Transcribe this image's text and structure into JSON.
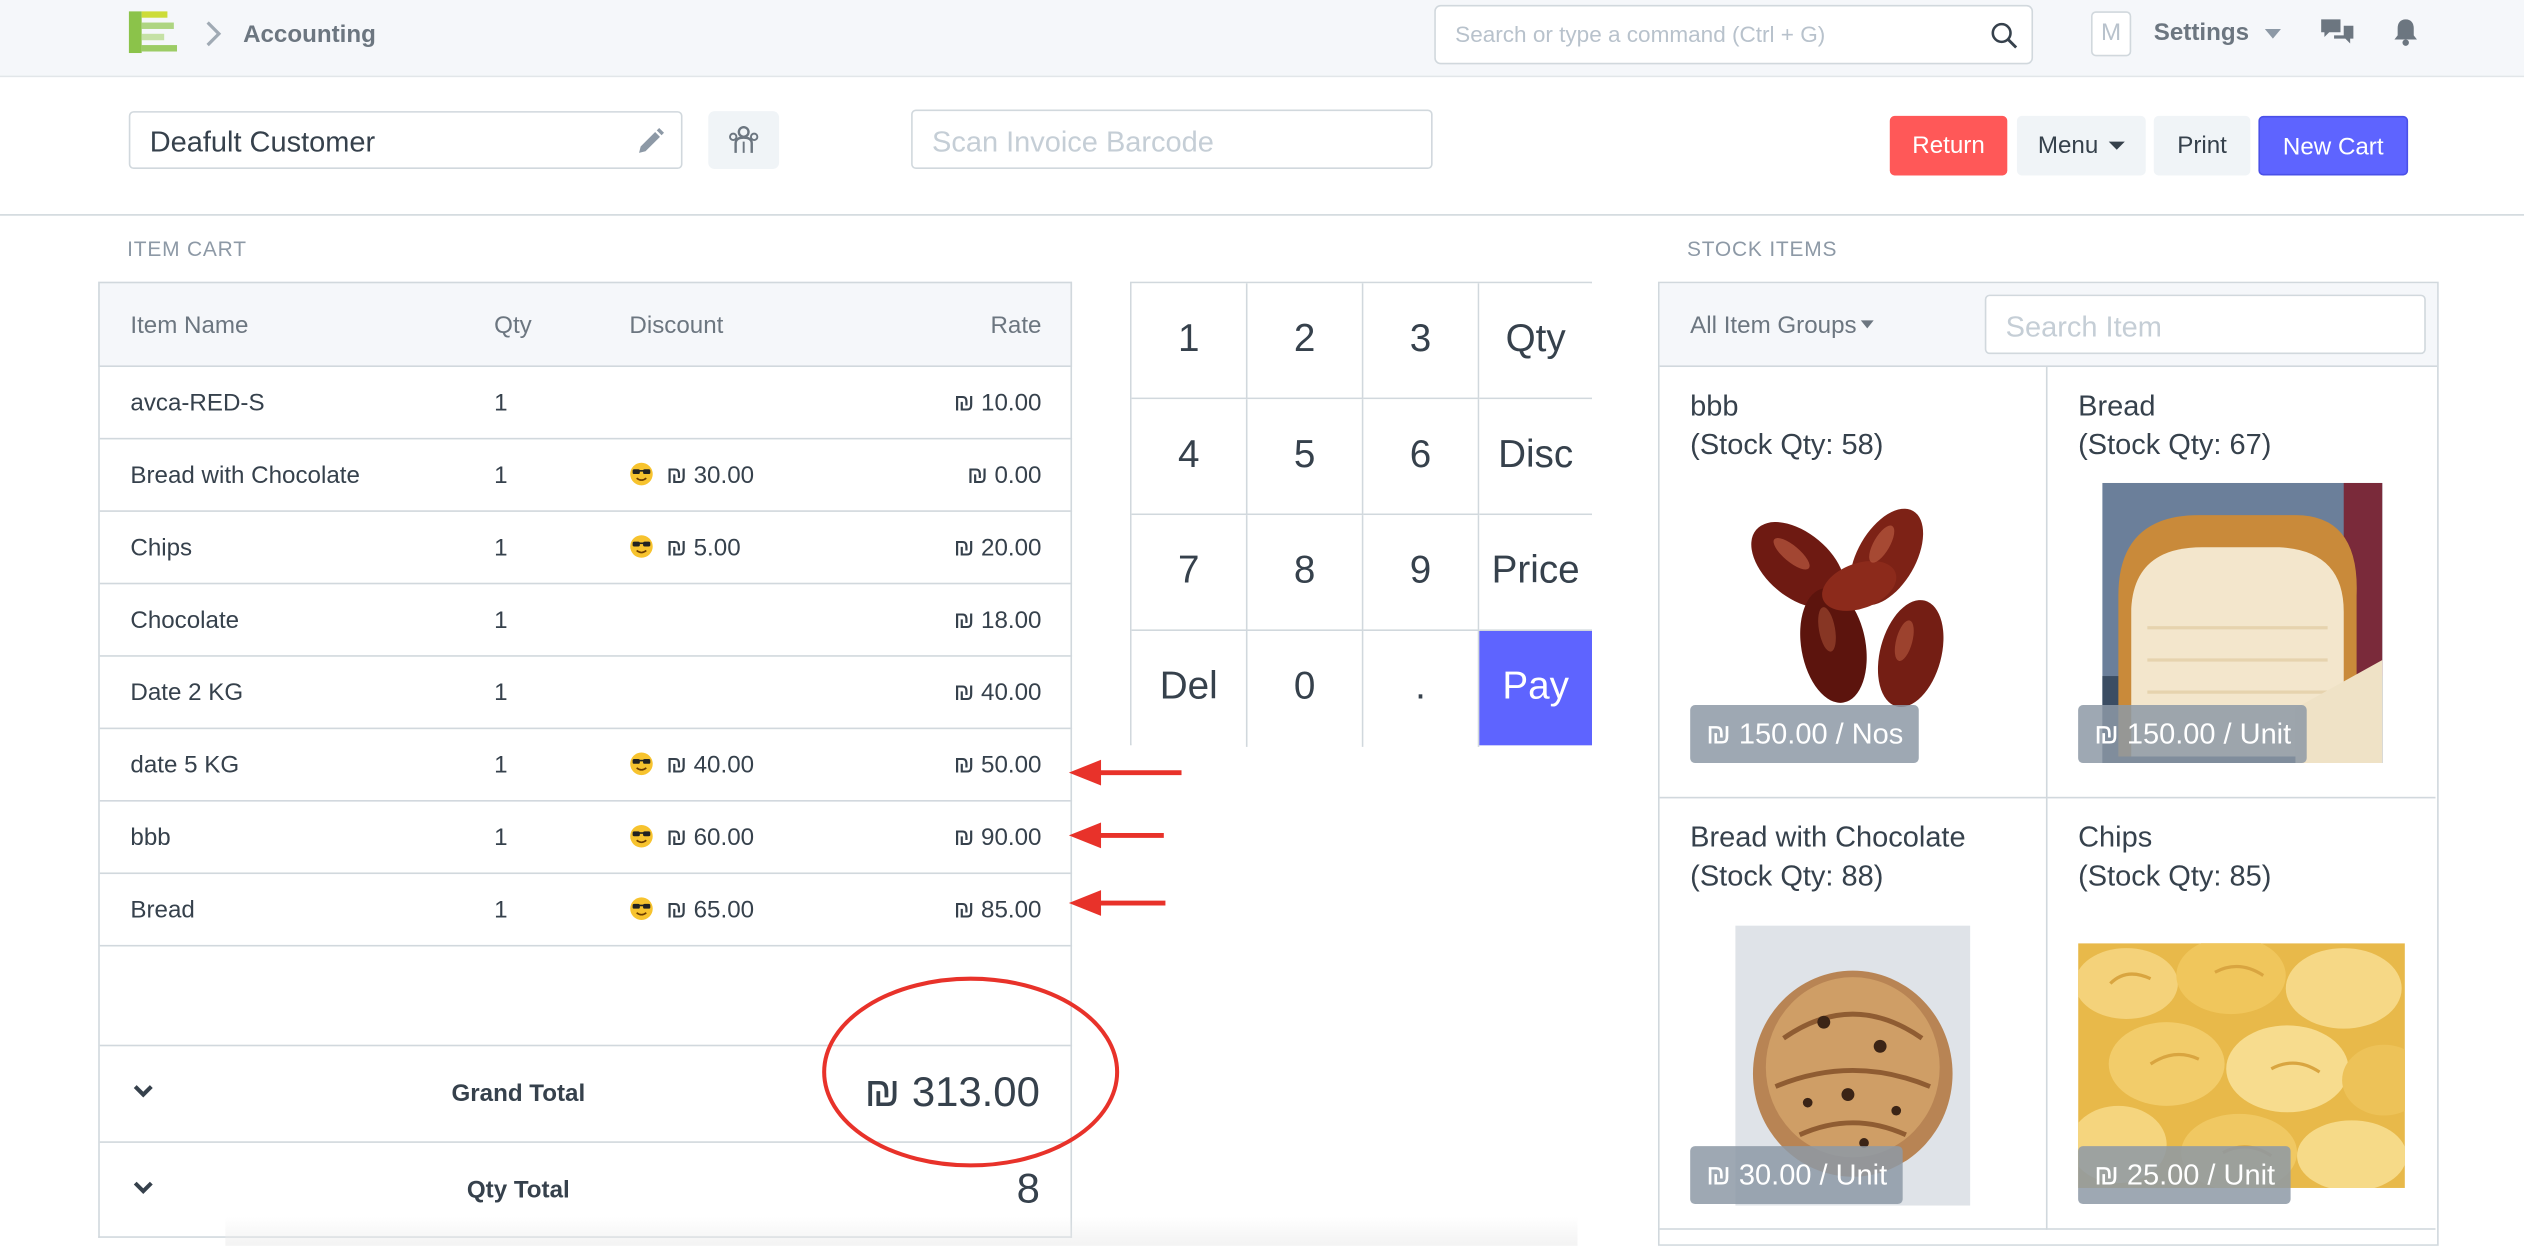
{
  "navbar": {
    "breadcrumb": "Accounting",
    "search_placeholder": "Search or type a command (Ctrl + G)",
    "avatar_initial": "M",
    "settings_label": "Settings"
  },
  "toolbar": {
    "customer": "Deafult Customer",
    "barcode_placeholder": "Scan Invoice Barcode",
    "return_label": "Return",
    "menu_label": "Menu",
    "print_label": "Print",
    "new_cart_label": "New Cart"
  },
  "cart": {
    "title": "ITEM CART",
    "columns": [
      "Item Name",
      "Qty",
      "Discount",
      "Rate"
    ],
    "rows": [
      {
        "name": "avca-RED-S",
        "qty": "1",
        "discount": "",
        "rate": "₪ 10.00"
      },
      {
        "name": "Bread with Chocolate",
        "qty": "1",
        "discount": "₪ 30.00",
        "rate": "₪ 0.00"
      },
      {
        "name": "Chips",
        "qty": "1",
        "discount": "₪ 5.00",
        "rate": "₪ 20.00"
      },
      {
        "name": "Chocolate",
        "qty": "1",
        "discount": "",
        "rate": "₪ 18.00"
      },
      {
        "name": "Date 2 KG",
        "qty": "1",
        "discount": "",
        "rate": "₪ 40.00"
      },
      {
        "name": "date 5 KG",
        "qty": "1",
        "discount": "₪ 40.00",
        "rate": "₪ 50.00"
      },
      {
        "name": "bbb",
        "qty": "1",
        "discount": "₪ 60.00",
        "rate": "₪ 90.00"
      },
      {
        "name": "Bread",
        "qty": "1",
        "discount": "₪ 65.00",
        "rate": "₪ 85.00"
      }
    ],
    "grand_total_label": "Grand Total",
    "grand_total": "₪ 313.00",
    "qty_total_label": "Qty Total",
    "qty_total": "8"
  },
  "numpad": {
    "keys": [
      "1",
      "2",
      "3",
      "Qty",
      "4",
      "5",
      "6",
      "Disc",
      "7",
      "8",
      "9",
      "Price",
      "Del",
      "0",
      ".",
      "Pay"
    ]
  },
  "stock": {
    "title": "STOCK ITEMS",
    "groups_label": "All Item Groups",
    "search_placeholder": "Search Item",
    "items": [
      {
        "name": "bbb",
        "stock": "(Stock Qty: 58)",
        "price": "₪ 150.00 / Nos"
      },
      {
        "name": "Bread",
        "stock": "(Stock Qty: 67)",
        "price": "₪ 150.00 / Unit"
      },
      {
        "name": "Bread with Chocolate",
        "stock": "(Stock Qty: 88)",
        "price": "₪ 30.00 / Unit"
      },
      {
        "name": "Chips",
        "stock": "(Stock Qty: 85)",
        "price": "₪ 25.00 / Unit"
      }
    ]
  },
  "colors": {
    "primary": "#5e64ff",
    "danger": "#ff5858",
    "annotation": "#e8322a"
  }
}
